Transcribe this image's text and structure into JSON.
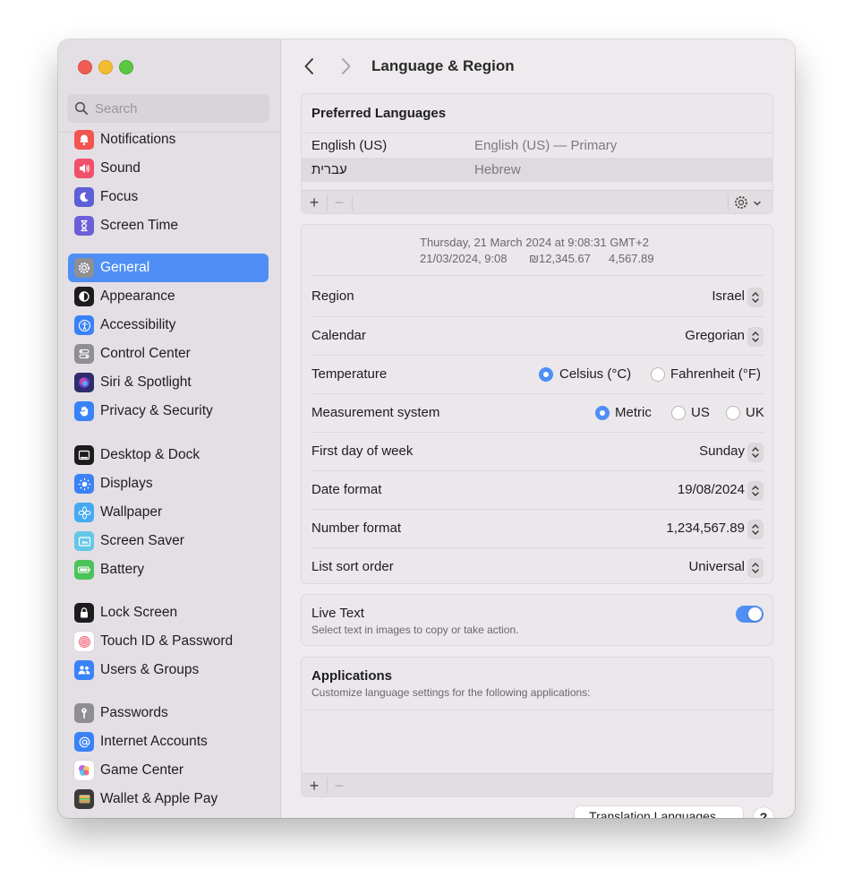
{
  "window": {
    "title": "Language & Region"
  },
  "search": {
    "placeholder": "Search"
  },
  "sidebar": {
    "items": [
      {
        "label": "Notifications",
        "icon": "bell-icon",
        "color": "#f25550"
      },
      {
        "label": "Sound",
        "icon": "speaker-icon",
        "color": "#f2506a"
      },
      {
        "label": "Focus",
        "icon": "moon-icon",
        "color": "#5d5fd6"
      },
      {
        "label": "Screen Time",
        "icon": "hourglass-icon",
        "color": "#6b5fd8"
      },
      {
        "label": "General",
        "icon": "gear-icon",
        "color": "#8e8e93",
        "selected": true
      },
      {
        "label": "Appearance",
        "icon": "appearance-icon",
        "color": "#1c1c1e"
      },
      {
        "label": "Accessibility",
        "icon": "accessibility-icon",
        "color": "#3a82f7"
      },
      {
        "label": "Control Center",
        "icon": "control-center-icon",
        "color": "#8e8e93"
      },
      {
        "label": "Siri & Spotlight",
        "icon": "siri-icon",
        "color": "#2d2d6b"
      },
      {
        "label": "Privacy & Security",
        "icon": "hand-icon",
        "color": "#3a82f7"
      },
      {
        "label": "Desktop & Dock",
        "icon": "dock-icon",
        "color": "#1c1c1e"
      },
      {
        "label": "Displays",
        "icon": "sun-icon",
        "color": "#3a82f7"
      },
      {
        "label": "Wallpaper",
        "icon": "flower-icon",
        "color": "#45aaf2"
      },
      {
        "label": "Screen Saver",
        "icon": "screen-saver-icon",
        "color": "#63c7e8"
      },
      {
        "label": "Battery",
        "icon": "battery-icon",
        "color": "#4cc35a"
      },
      {
        "label": "Lock Screen",
        "icon": "lock-icon",
        "color": "#1c1c1e"
      },
      {
        "label": "Touch ID & Password",
        "icon": "fingerprint-icon",
        "color": "#ffffff"
      },
      {
        "label": "Users & Groups",
        "icon": "users-icon",
        "color": "#3a82f7"
      },
      {
        "label": "Passwords",
        "icon": "key-icon",
        "color": "#8e8e93"
      },
      {
        "label": "Internet Accounts",
        "icon": "at-icon",
        "color": "#3a82f7"
      },
      {
        "label": "Game Center",
        "icon": "game-center-icon",
        "color": "#ffffff"
      },
      {
        "label": "Wallet & Apple Pay",
        "icon": "wallet-icon",
        "color": "#3b3b3b"
      }
    ]
  },
  "preferred_languages": {
    "title": "Preferred Languages",
    "languages": [
      {
        "name": "English (US)",
        "description": "English (US) — Primary"
      },
      {
        "name": "עברית",
        "description": "Hebrew"
      }
    ],
    "add_label": "+",
    "remove_label": "−"
  },
  "format_preview": {
    "line1": "Thursday, 21 March 2024 at 9:08:31 GMT+2",
    "date_short": "21/03/2024, 9:08",
    "currency": "₪12,345.67",
    "number": "4,567.89"
  },
  "settings": {
    "region": {
      "label": "Region",
      "value": "Israel"
    },
    "calendar": {
      "label": "Calendar",
      "value": "Gregorian"
    },
    "temperature": {
      "label": "Temperature",
      "options": [
        "Celsius (°C)",
        "Fahrenheit (°F)"
      ],
      "selected": "Celsius (°C)"
    },
    "measurement": {
      "label": "Measurement system",
      "options": [
        "Metric",
        "US",
        "UK"
      ],
      "selected": "Metric"
    },
    "first_day": {
      "label": "First day of week",
      "value": "Sunday"
    },
    "date_format": {
      "label": "Date format",
      "value": "19/08/2024"
    },
    "number_format": {
      "label": "Number format",
      "value": "1,234,567.89"
    },
    "list_sort": {
      "label": "List sort order",
      "value": "Universal"
    }
  },
  "live_text": {
    "title": "Live Text",
    "subtitle": "Select text in images to copy or take action.",
    "enabled": true
  },
  "applications": {
    "title": "Applications",
    "subtitle": "Customize language settings for the following applications:",
    "add_label": "+",
    "remove_label": "−"
  },
  "footer": {
    "translation_button": "Translation Languages…",
    "help_label": "?"
  },
  "colors": {
    "accent": "#4f8ff5"
  }
}
